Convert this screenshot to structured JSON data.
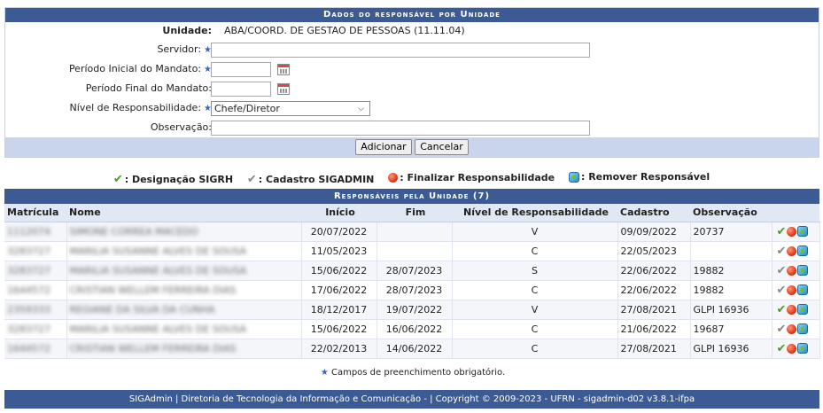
{
  "form": {
    "caption": "Dados do responsável por Unidade",
    "unidade_label": "Unidade:",
    "unidade_value": "ABA/COORD. DE GESTAO DE PESSOAS (11.11.04)",
    "servidor_label": "Servidor:",
    "servidor_value": "",
    "periodo_inicial_label": "Período Inicial do Mandato:",
    "periodo_inicial_value": "",
    "periodo_final_label": "Período Final do Mandato:",
    "periodo_final_value": "",
    "nivel_label": "Nível de Responsabilidade:",
    "nivel_selected": "Chefe/Diretor",
    "observacao_label": "Observação:",
    "observacao_value": "",
    "add_label": "Adicionar",
    "cancel_label": "Cancelar"
  },
  "legend": {
    "designacao": ": Designação SIGRH",
    "cadastro": ": Cadastro SIGADMIN",
    "finalizar": ": Finalizar Responsabilidade",
    "remover": ": Remover Responsável"
  },
  "list": {
    "caption": "Responsáveis pela Unidade (7)",
    "headers": [
      "Matrícula",
      "Nome",
      "Início",
      "Fim",
      "Nível de Responsabilidade",
      "Cadastro",
      "Observação"
    ],
    "rows": [
      {
        "matricula": "1112074",
        "nome": "SIMONE CORREA MACEDO",
        "inicio": "20/07/2022",
        "fim": "",
        "nivel": "V",
        "cadastro": "09/09/2022",
        "obs": "20737",
        "icon": "check-green"
      },
      {
        "matricula": "3283727",
        "nome": "MARILIA SUSANNE ALVES DE SOUSA",
        "inicio": "11/05/2023",
        "fim": "",
        "nivel": "C",
        "cadastro": "22/05/2023",
        "obs": "",
        "icon": "check-gray"
      },
      {
        "matricula": "3283727",
        "nome": "MARILIA SUSANNE ALVES DE SOUSA",
        "inicio": "15/06/2022",
        "fim": "28/07/2023",
        "nivel": "S",
        "cadastro": "22/06/2022",
        "obs": "19882",
        "icon": "check-gray"
      },
      {
        "matricula": "1644572",
        "nome": "CRISTIAN WELLEM FERREIRA DIAS",
        "inicio": "17/06/2022",
        "fim": "28/07/2023",
        "nivel": "C",
        "cadastro": "22/06/2022",
        "obs": "19882",
        "icon": "check-gray"
      },
      {
        "matricula": "2359333",
        "nome": "REGIANE DA SILVA DA CUNHA",
        "inicio": "18/12/2017",
        "fim": "19/07/2022",
        "nivel": "V",
        "cadastro": "27/08/2021",
        "obs": "GLPI 16936",
        "icon": "check-green"
      },
      {
        "matricula": "3283727",
        "nome": "MARILIA SUSANNE ALVES DE SOUSA",
        "inicio": "15/06/2022",
        "fim": "16/06/2022",
        "nivel": "C",
        "cadastro": "21/06/2022",
        "obs": "19687",
        "icon": "check-gray"
      },
      {
        "matricula": "1644572",
        "nome": "CRISTIAN WELLEM FERREIRA DIAS",
        "inicio": "22/02/2013",
        "fim": "14/06/2022",
        "nivel": "C",
        "cadastro": "27/08/2021",
        "obs": "GLPI 16936",
        "icon": "check-green"
      }
    ]
  },
  "required_note": "Campos de preenchimento obrigatório.",
  "footer": "SIGAdmin | Diretoria de Tecnologia da Informação e Comunicação - | Copyright © 2009-2023 - UFRN - sigadmin-d02 v3.8.1-ifpa",
  "colors": {
    "header_blue": "#3c5a93",
    "button_bar": "#c9d5ec",
    "required_star": "#3366cc"
  }
}
